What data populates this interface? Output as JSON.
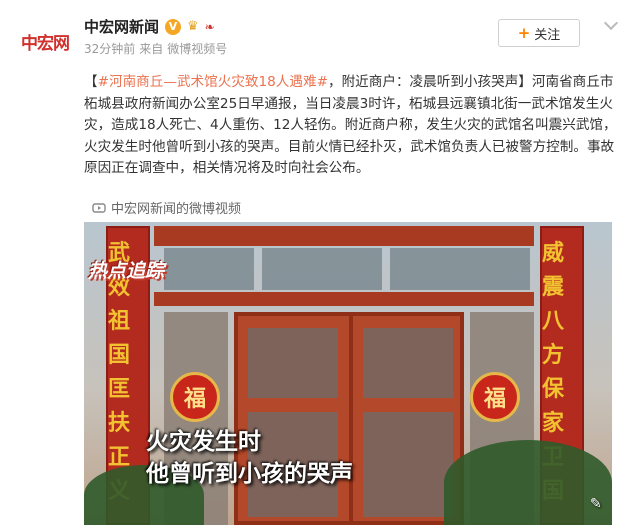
{
  "account": {
    "avatar_text": "中宏网",
    "name": "中宏网新闻",
    "verified_badge": "V",
    "time": "32分钟前",
    "source_prefix": "来自",
    "source": "微博视频号",
    "follow_label": "关注"
  },
  "post": {
    "topic": "#河南商丘—武术馆火灾致18人遇难#",
    "text": "，附近商户：凌晨听到小孩哭声】河南省商丘市柘城县政府新闻办公室25日早通报，当日凌晨3时许，柘城县远襄镇北街一武术馆发生火灾，造成18人死亡、4人重伤、12人轻伤。附近商户称，发生火灾的武馆名叫震兴武馆，火灾发生时他曾听到小孩的哭声。目前火情已经扑灭，武术馆负责人已被警方控制。事故原因正在调查中，相关情况将及时向社会公布。",
    "bracket_open": "【",
    "video_source": "中宏网新闻的微博视频"
  },
  "video": {
    "logo": "热点追踪",
    "banner_left": "武效祖国匡扶正义",
    "banner_right": "威震八方保家卫国",
    "fu_char": "福",
    "caption_line1": "火灾发生时",
    "caption_line2": "他曾听到小孩的哭声"
  },
  "icons": {
    "verified": "verified-badge-icon",
    "crown": "crown-icon",
    "follow_plus": "plus-icon",
    "dropdown": "chevron-down-icon",
    "video_link": "link-icon"
  },
  "colors": {
    "topic": "#eb7350",
    "follow_plus": "#ff8200",
    "avatar_red": "#d0312d"
  }
}
